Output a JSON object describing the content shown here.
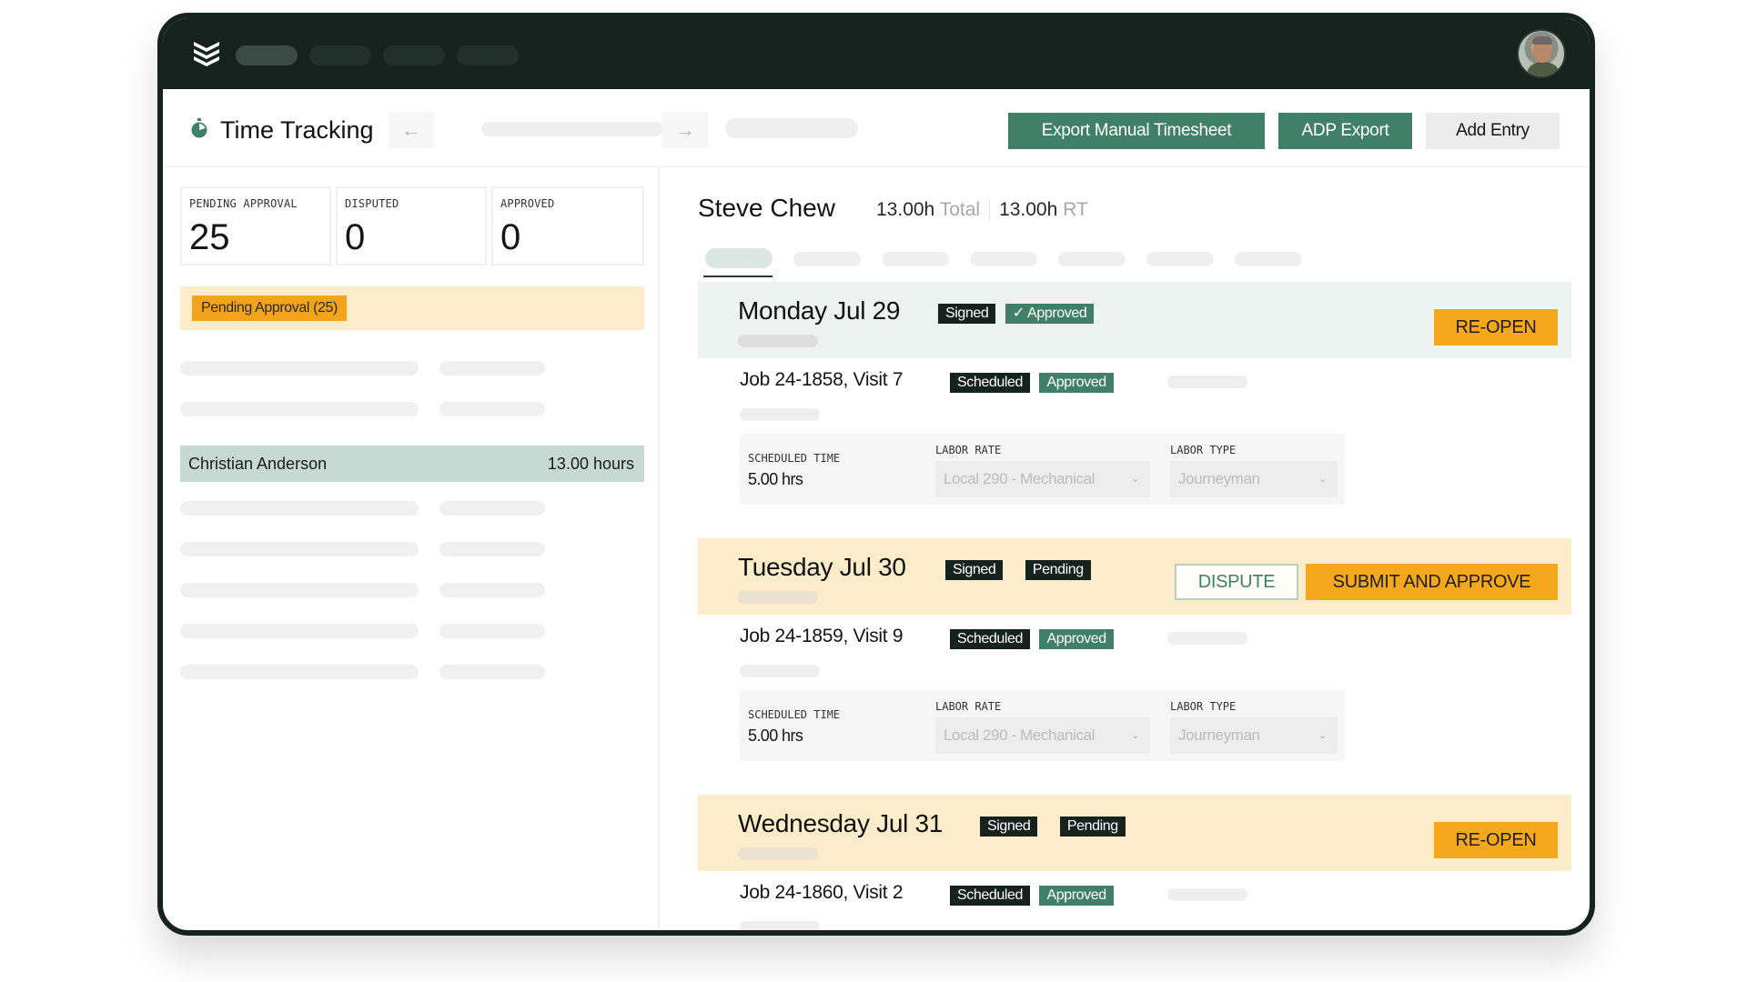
{
  "app": {
    "logo_icon": "stacked-chevrons-logo",
    "avatar_icon": "user-avatar-photo"
  },
  "toolbar": {
    "title": "Time Tracking",
    "title_icon": "stopwatch-icon",
    "prev_icon": "←",
    "next_icon": "→",
    "export_manual_label": "Export Manual Timesheet",
    "adp_export_label": "ADP Export",
    "add_entry_label": "Add Entry"
  },
  "stats": [
    {
      "label": "PENDING APPROVAL",
      "value": "25"
    },
    {
      "label": "DISPUTED",
      "value": "0"
    },
    {
      "label": "APPROVED",
      "value": "0"
    }
  ],
  "filter": {
    "label": "Pending Approval (25)"
  },
  "employee_list": {
    "selected": {
      "name": "Christian Anderson",
      "hours": "13.00 hours"
    }
  },
  "detail": {
    "employee_name": "Steve Chew",
    "total_hours": "13.00h",
    "total_label": "Total",
    "rt_hours": "13.00h",
    "rt_label": "RT",
    "days": [
      {
        "title": "Monday Jul 29",
        "badges": [
          "Signed",
          "✓ Approved"
        ],
        "actions": [
          "RE-OPEN"
        ],
        "jobs": [
          {
            "title": "Job 24-1858, Visit 7",
            "badges": [
              "Scheduled",
              "Approved"
            ],
            "scheduled_time_label": "SCHEDULED TIME",
            "scheduled_time": "5.00 hrs",
            "labor_rate_label": "LABOR RATE",
            "labor_rate": "Local 290 - Mechanical",
            "labor_type_label": "LABOR TYPE",
            "labor_type": "Journeyman"
          }
        ]
      },
      {
        "title": "Tuesday Jul 30",
        "badges": [
          "Signed",
          "Pending"
        ],
        "actions": [
          "DISPUTE",
          "SUBMIT AND APPROVE"
        ],
        "jobs": [
          {
            "title": "Job 24-1859, Visit 9",
            "badges": [
              "Scheduled",
              "Approved"
            ],
            "scheduled_time_label": "SCHEDULED TIME",
            "scheduled_time": "5.00 hrs",
            "labor_rate_label": "LABOR RATE",
            "labor_rate": "Local 290 - Mechanical",
            "labor_type_label": "LABOR TYPE",
            "labor_type": "Journeyman"
          }
        ]
      },
      {
        "title": "Wednesday Jul 31",
        "badges": [
          "Signed",
          "Pending"
        ],
        "actions": [
          "RE-OPEN"
        ],
        "jobs": [
          {
            "title": "Job 24-1860, Visit 2",
            "badges": [
              "Scheduled",
              "Approved"
            ]
          }
        ]
      }
    ]
  },
  "colors": {
    "topbar": "#15221d",
    "brand_green": "#3f8066",
    "accent_orange": "#f6a81d",
    "pending_bg": "#fdecc9",
    "approved_bg": "#edf3f1",
    "selected_row": "#c6dad3"
  }
}
